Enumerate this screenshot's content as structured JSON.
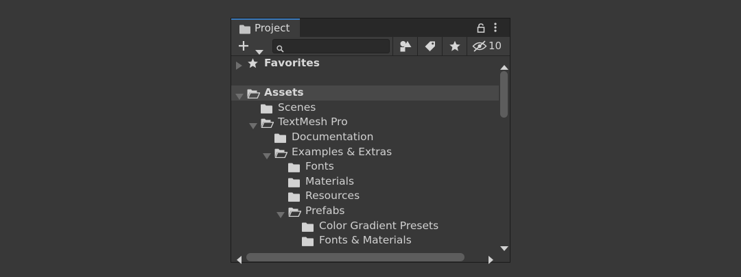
{
  "window": {
    "tab_label": "Project",
    "tab_icon": "folder-icon",
    "lock_icon": "lock-icon",
    "menu_icon": "kebab-menu-icon"
  },
  "toolbar": {
    "create_icon": "plus-icon",
    "search": {
      "value": "",
      "placeholder": ""
    },
    "filter_type_icon": "shapes-icon",
    "filter_label_icon": "tag-icon",
    "favorite_icon": "star-icon",
    "hidden_icon": "eye-slash-icon",
    "hidden_count": "10"
  },
  "tree": {
    "favorites_label": "Favorites",
    "assets_label": "Assets",
    "items": [
      {
        "label": "Scenes",
        "depth": 1,
        "expanded": false,
        "has_children": false
      },
      {
        "label": "TextMesh Pro",
        "depth": 1,
        "expanded": true,
        "has_children": true
      },
      {
        "label": "Documentation",
        "depth": 2,
        "expanded": false,
        "has_children": false
      },
      {
        "label": "Examples & Extras",
        "depth": 2,
        "expanded": true,
        "has_children": true
      },
      {
        "label": "Fonts",
        "depth": 3,
        "expanded": false,
        "has_children": false
      },
      {
        "label": "Materials",
        "depth": 3,
        "expanded": false,
        "has_children": false
      },
      {
        "label": "Resources",
        "depth": 3,
        "expanded": false,
        "has_children": false
      },
      {
        "label": "Prefabs",
        "depth": 3,
        "expanded": true,
        "has_children": true
      },
      {
        "label": "Color Gradient Presets",
        "depth": 4,
        "expanded": false,
        "has_children": false
      },
      {
        "label": "Fonts & Materials",
        "depth": 4,
        "expanded": false,
        "has_children": false
      }
    ]
  },
  "colors": {
    "background": "#383838",
    "panel": "#383838",
    "toolbar": "#3c3c3c",
    "selected_row": "#484848",
    "tab_accent": "#3a79bb",
    "text": "#d2d2d2"
  }
}
